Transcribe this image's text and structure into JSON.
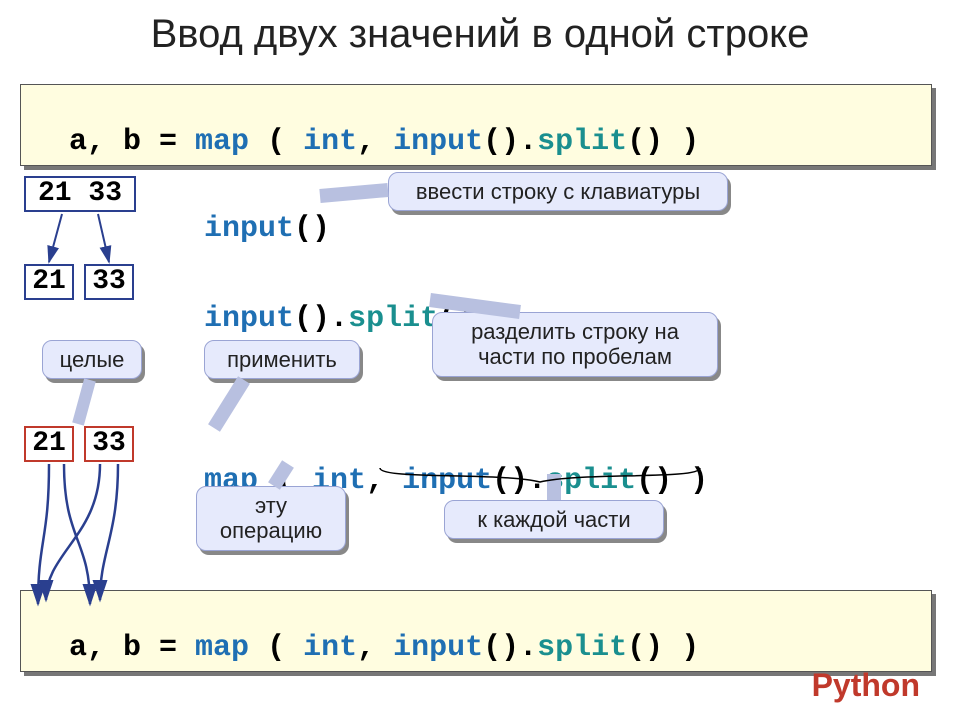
{
  "title": "Ввод двух значений в одной строке",
  "code": {
    "assign": "a, b = ",
    "map": "map",
    "open_sp": " ( ",
    "int": "int",
    "comma_sp": ", ",
    "input": "input",
    "parens": "()",
    "dot": ".",
    "split": "split",
    "close_sp": " )"
  },
  "line1": {
    "input": "input",
    "parens": "()"
  },
  "line2": {
    "input": "input",
    "parens": "()",
    "dot": ".",
    "split": "split"
  },
  "line3": {
    "map": "map",
    "open_sp": " ( ",
    "int": "int",
    "comma_sp": ", ",
    "input": "input",
    "parens": "()",
    "dot": ".",
    "split": "split",
    "close_sp": " )"
  },
  "vals": {
    "pair": "21 33",
    "a": "21",
    "b": "33"
  },
  "callouts": {
    "keyboard": "ввести строку с клавиатуры",
    "split": "разделить строку на части по пробелам",
    "int_label": "целые",
    "apply": "применить",
    "thisop": "эту операцию",
    "eachpart": "к каждой части"
  },
  "footer": "Python"
}
